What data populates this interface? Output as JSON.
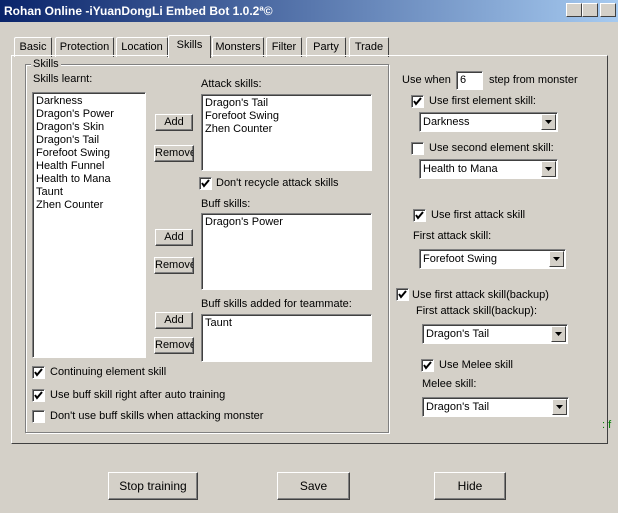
{
  "window": {
    "title": "Rohan Online -iYuanDongLi Embed Bot 1.0.2ª©"
  },
  "tabs": [
    {
      "label": "Basic"
    },
    {
      "label": "Protection"
    },
    {
      "label": "Location"
    },
    {
      "label": "Skills",
      "active": true
    },
    {
      "label": "Monsters"
    },
    {
      "label": "Filter"
    },
    {
      "label": "Party"
    },
    {
      "label": "Trade"
    }
  ],
  "skills_group": {
    "legend": "Skills",
    "learnt_label": "Skills learnt:",
    "learnt": [
      "Darkness",
      "Dragon's Power",
      "Dragon's Skin",
      "Dragon's Tail",
      "Forefoot Swing",
      "Health Funnel",
      "Health to Mana",
      "Taunt",
      "Zhen Counter"
    ],
    "attack_label": "Attack skills:",
    "attack": [
      "Dragon's Tail",
      "Forefoot Swing",
      "Zhen Counter"
    ],
    "dont_recycle_label": "Don't recycle attack skills",
    "buff_label": "Buff skills:",
    "buff": [
      "Dragon's Power"
    ],
    "team_buff_label": "Buff skills added for teammate:",
    "team_buff": [
      "Taunt"
    ],
    "add_label": "Add",
    "remove_label": "Remove",
    "continuing_element_label": "Continuing element skill",
    "use_buff_after_training_label": "Use buff skill right after auto training",
    "dont_use_buff_attacking_label": "Don't use buff skills when attacking monster"
  },
  "right": {
    "use_when_label": "Use when",
    "use_when_value": "6",
    "step_label": "step from monster",
    "use_first_element_label": "Use first element skill:",
    "first_element_value": "Darkness",
    "use_second_element_label": "Use second element skill:",
    "second_element_value": "Health to Mana",
    "use_first_attack_label": "Use first attack skill",
    "first_attack_label": "First attack skill:",
    "first_attack_value": "Forefoot Swing",
    "use_first_attack_backup_label": "Use first attack skill(backup)",
    "first_attack_backup_label": "First attack skill(backup):",
    "first_attack_backup_value": "Dragon's Tail",
    "use_melee_label": "Use Melee skill",
    "melee_label": "Melee skill:",
    "melee_value": "Dragon's Tail"
  },
  "checkboxes": {
    "dont_recycle": true,
    "continuing_element": true,
    "use_buff_after_training": true,
    "dont_use_buff_attacking": false,
    "use_first_element": true,
    "use_second_element": false,
    "use_first_attack": true,
    "use_first_attack_backup": true,
    "use_melee": true
  },
  "edge_mark": ": f",
  "footer": {
    "stop_label": "Stop training",
    "save_label": "Save",
    "hide_label": "Hide"
  }
}
